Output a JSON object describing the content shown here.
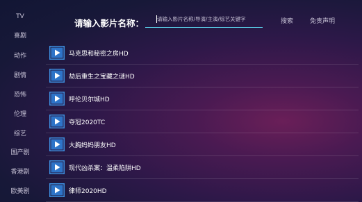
{
  "sidebar": {
    "items": [
      {
        "label": "TV"
      },
      {
        "label": "喜剧"
      },
      {
        "label": "动作"
      },
      {
        "label": "剧情"
      },
      {
        "label": "恐怖"
      },
      {
        "label": "伦理"
      },
      {
        "label": "综艺"
      },
      {
        "label": "国产剧"
      },
      {
        "label": "香港剧"
      },
      {
        "label": "欧美剧"
      }
    ]
  },
  "search": {
    "label": "请输入影片名称：",
    "placeholder": "请输入影片名称/导演/主演/综艺关键字",
    "search_button": "搜索",
    "disclaimer_button": "免责声明"
  },
  "results": [
    {
      "title": "马克思和秘密之房HD",
      "icon": "video-play-icon"
    },
    {
      "title": "劫后重生之宝藏之谜HD",
      "icon": "video-play-icon"
    },
    {
      "title": "呼伦贝尔城HD",
      "icon": "video-play-icon"
    },
    {
      "title": "夺冠2020TC",
      "icon": "video-play-icon"
    },
    {
      "title": "大胸妈妈朋友HD",
      "icon": "video-play-icon"
    },
    {
      "title": "现代凶杀案：温柔陷阱HD",
      "icon": "video-play-icon"
    },
    {
      "title": "律师2020HD",
      "icon": "video-play-icon"
    }
  ],
  "colors": {
    "accent_underline": "#5ad1ea",
    "icon_blue": "#3d8fe0"
  }
}
